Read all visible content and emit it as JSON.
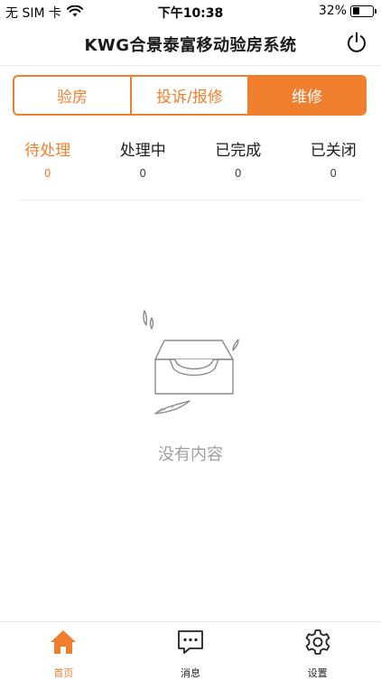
{
  "status_bar": {
    "carrier": "无 SIM 卡",
    "time": "下午10:38",
    "battery_pct": "32%",
    "battery_level": 0.32,
    "icons": [
      "wifi-icon",
      "battery-icon"
    ]
  },
  "header": {
    "title": "KWG合景泰富移动验房系统",
    "power_icon": "power-icon"
  },
  "segments": [
    {
      "label": "验房",
      "active": false
    },
    {
      "label": "投诉/报修",
      "active": false
    },
    {
      "label": "维修",
      "active": true
    }
  ],
  "status_tabs": [
    {
      "label": "待处理",
      "count": "0",
      "active": true
    },
    {
      "label": "处理中",
      "count": "0",
      "active": false
    },
    {
      "label": "已完成",
      "count": "0",
      "active": false
    },
    {
      "label": "已关闭",
      "count": "0",
      "active": false
    }
  ],
  "empty_state": {
    "text": "没有内容",
    "icon": "empty-tray-icon"
  },
  "tabbar": [
    {
      "label": "首页",
      "icon": "home-icon",
      "active": true
    },
    {
      "label": "消息",
      "icon": "message-icon",
      "active": false
    },
    {
      "label": "设置",
      "icon": "gear-icon",
      "active": false
    }
  ],
  "colors": {
    "accent": "#ef7f2d",
    "text": "#1a1a1a",
    "muted": "#9e9e9e",
    "divider": "#ececec"
  }
}
